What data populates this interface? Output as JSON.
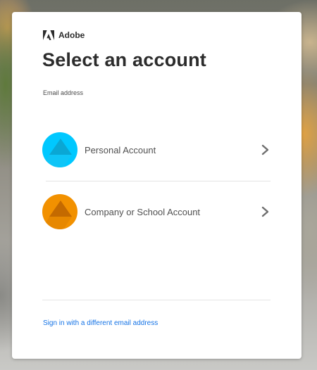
{
  "brand": {
    "name": "Adobe",
    "logo_icon": "adobe-logo-icon"
  },
  "page": {
    "title": "Select an account",
    "email_label": "Email address"
  },
  "accounts": [
    {
      "label": "Personal Account",
      "icon": "personal-account-icon",
      "color": "#00c8ff",
      "color_dark": "#0aa7d4"
    },
    {
      "label": "Company or School Account",
      "icon": "company-account-icon",
      "color": "#f29100",
      "color_dark": "#c46a00"
    }
  ],
  "footer": {
    "alt_signin": "Sign in with a different email address"
  },
  "colors": {
    "link": "#1473e6",
    "title": "#2c2c2c",
    "chevron": "#6e6e6e"
  }
}
